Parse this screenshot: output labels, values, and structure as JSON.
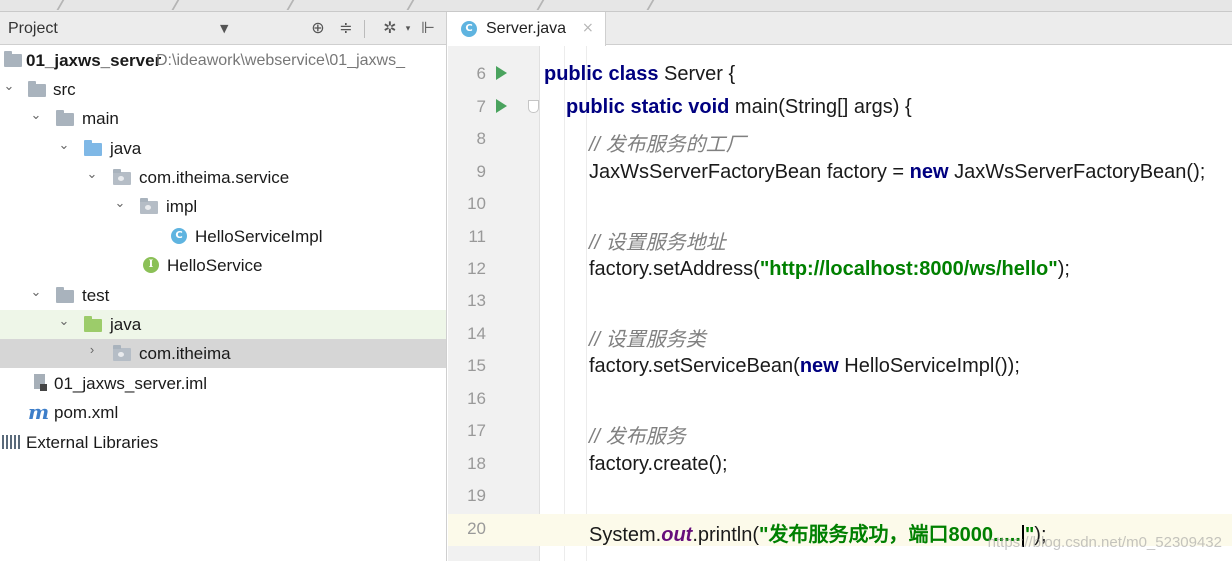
{
  "project_panel": {
    "title": "Project",
    "tree": [
      {
        "label": "01_jaxws_server",
        "path": "D:\\ideawork\\webservice\\01_jaxws_",
        "icon": "module-folder-icon"
      },
      {
        "label": "src",
        "icon": "folder-icon"
      },
      {
        "label": "main",
        "icon": "folder-icon"
      },
      {
        "label": "java",
        "icon": "source-folder-icon"
      },
      {
        "label": "com.itheima.service",
        "icon": "package-icon"
      },
      {
        "label": "impl",
        "icon": "package-icon"
      },
      {
        "label": "HelloServiceImpl",
        "icon": "class-icon"
      },
      {
        "label": "HelloService",
        "icon": "interface-icon"
      },
      {
        "label": "test",
        "icon": "folder-icon"
      },
      {
        "label": "java",
        "icon": "test-source-folder-icon"
      },
      {
        "label": "com.itheima",
        "icon": "package-icon"
      },
      {
        "label": "01_jaxws_server.iml",
        "icon": "iml-file-icon"
      },
      {
        "label": "pom.xml",
        "icon": "maven-icon"
      },
      {
        "label": "External Libraries",
        "icon": "libraries-icon"
      }
    ],
    "class_icon_letter": "C",
    "interface_icon_letter": "I"
  },
  "editor": {
    "tab": {
      "label": "Server.java",
      "close": "×"
    },
    "line_numbers": [
      "6",
      "7",
      "8",
      "9",
      "10",
      "11",
      "12",
      "13",
      "14",
      "15",
      "16",
      "17",
      "18",
      "19",
      "20"
    ],
    "line6": {
      "kw": "public class",
      "rest": " Server {"
    },
    "line7": {
      "kw": "public static void",
      "rest": " main(String[] args) {"
    },
    "line8": {
      "comment": "// 发布服务的工厂"
    },
    "line9": {
      "pre": "JaxWsServerFactoryBean factory = ",
      "kw": "new",
      "post": " JaxWsServerFactoryBean();"
    },
    "line11": {
      "comment": "// 设置服务地址"
    },
    "line12": {
      "pre": "factory.setAddress(",
      "str": "\"http://localhost:8000/ws/hello\"",
      "post": ");"
    },
    "line14": {
      "comment": "// 设置服务类"
    },
    "line15": {
      "pre": "factory.setServiceBean(",
      "kw": "new",
      "post": " HelloServiceImpl());"
    },
    "line17": {
      "comment": "// 发布服务"
    },
    "line18": {
      "pre": "factory.create();"
    },
    "line20": {
      "pre": "System.",
      "field": "out",
      "mid": ".println(",
      "str": "\"发布服务成功，端口8000.....",
      "str_end": "\"",
      "post": ");"
    }
  },
  "watermark": "https://blog.csdn.net/m0_52309432",
  "colors": {
    "keyword": "#000080",
    "string": "#008000",
    "comment": "#808080",
    "field": "#660e7a",
    "current_line": "#fcfaea"
  }
}
